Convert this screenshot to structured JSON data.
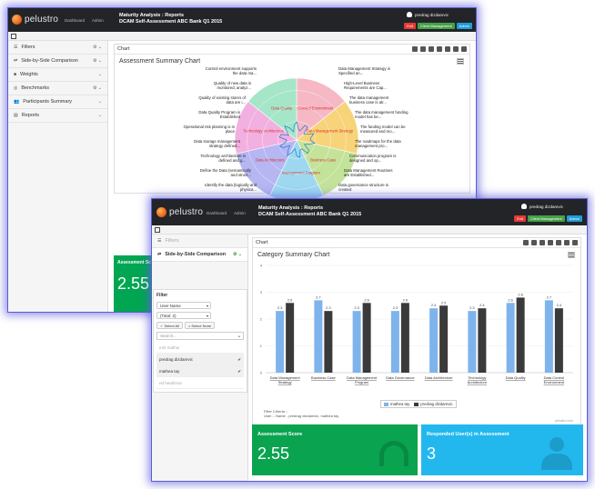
{
  "colors": {
    "topbar": "#222427",
    "accent_red": "#e53935",
    "accent_green": "#43a047",
    "accent_blue": "#1e9cd8",
    "score_green": "#0aa34f",
    "users_cyan": "#22b8ee",
    "series_1": "#7fb3ec",
    "series_2": "#3a3a3a"
  },
  "app": {
    "logo_text": "pelustro",
    "nav_dashboard": "Dashboard",
    "nav_admin": "Admin",
    "title_line1": "Maturity Analysis : Reports",
    "title_line2": "DCAM Self-Assessment ABC Bank Q1 2015",
    "user_name": "predrag dizdarevic",
    "btn_exit": "Exit",
    "btn_client_mgmt": "Client Management",
    "btn_admin": "Admin"
  },
  "sidebar": {
    "items": [
      {
        "label": "Filters",
        "icon": "filter-icon"
      },
      {
        "label": "Side-by-Side Comparison",
        "icon": "compare-icon"
      },
      {
        "label": "Weights",
        "icon": "weights-icon"
      },
      {
        "label": "Benchmarks",
        "icon": "benchmark-icon"
      },
      {
        "label": "Participants Summary",
        "icon": "participants-icon"
      },
      {
        "label": "Reports",
        "icon": "reports-icon"
      }
    ]
  },
  "back_window": {
    "panel_label": "Chart",
    "chart_title": "Assessment Summary Chart",
    "score_label": "Assessment Score",
    "score_value": "2.55",
    "radar_labels_left": [
      "Control environment supports the data ma...",
      "Quality of new data is monitored, analyz...",
      "Quality of existing stores of data are i...",
      "Data Quality Program is Established",
      "Operational risk planning is in place",
      "Data storage management strategy defined...",
      "Technology architecture is defined and g...",
      "Define the Data (semantically and struct...",
      "Identify the data (logically and physica..."
    ],
    "radar_labels_right": [
      "Data Management Strategy is Specified an...",
      "High-Level Business Requirements are Cap...",
      "The data management business case is alr...",
      "The data management funding model has be...",
      "The funding model can be measured and mo...",
      "The roadmaps for the data management pro...",
      "Communication program is designed and op...",
      "Data Management Routines are Established...",
      "Data governance structure is created"
    ],
    "radar_segments": [
      "Data Control Environment",
      "Data Management Strategy",
      "Business Case",
      "Data Management Program",
      "Data Architecture",
      "Technology Architecture",
      "Data Quality"
    ]
  },
  "front_window": {
    "panel_label": "Chart",
    "chart_title": "Category Summary Chart",
    "filter": {
      "title": "Filter",
      "select_type": "User Name",
      "select_count": "(Total: 2)",
      "btn_select_all": "✓ Select All",
      "btn_select_none": "× Select None",
      "search_placeholder": "Search...",
      "options": [
        {
          "label": "mrit mathur",
          "selected": false
        },
        {
          "label": "predrag dizdarevic",
          "selected": true
        },
        {
          "label": "mathea tay",
          "selected": true
        },
        {
          "label": "ed heathrow",
          "selected": false
        }
      ]
    },
    "filter_criteria_line1": "Filter Criteria :-",
    "filter_criteria_line2": "User :- Name - predrag dizdarevic, mathea tay",
    "watermark": "pelustro.com",
    "score_label": "Assessment Score",
    "score_value": "2.55",
    "users_label": "Responded User(s) in Assessment",
    "users_value": "3"
  },
  "chart_data": {
    "type": "bar",
    "categories": [
      "Data Management Strategy",
      "Business Case",
      "Data Management Program",
      "Data Governance",
      "Data Architecture",
      "Technology Architecture",
      "Data Quality",
      "Data Control Environment"
    ],
    "category_lines": [
      [
        "Data Management",
        "Strategy"
      ],
      [
        "Business Case"
      ],
      [
        "Data Management",
        "Program"
      ],
      [
        "Data Governance"
      ],
      [
        "Data Architecture"
      ],
      [
        "Technology",
        "Architecture"
      ],
      [
        "Data Quality"
      ],
      [
        "Data Control",
        "Environment"
      ]
    ],
    "series": [
      {
        "name": "mathea tay",
        "values": [
          2.3,
          2.7,
          2.3,
          2.3,
          2.4,
          2.3,
          2.6,
          2.7
        ]
      },
      {
        "name": "predrag dizdarevic",
        "values": [
          2.6,
          2.3,
          2.6,
          2.6,
          2.5,
          2.4,
          2.8,
          2.4
        ]
      }
    ],
    "ylim": [
      0,
      4
    ],
    "yticks": [
      0,
      1,
      2,
      3,
      4
    ],
    "title": "Category Summary Chart",
    "legend_placement": "bottom-center",
    "grid": true
  }
}
